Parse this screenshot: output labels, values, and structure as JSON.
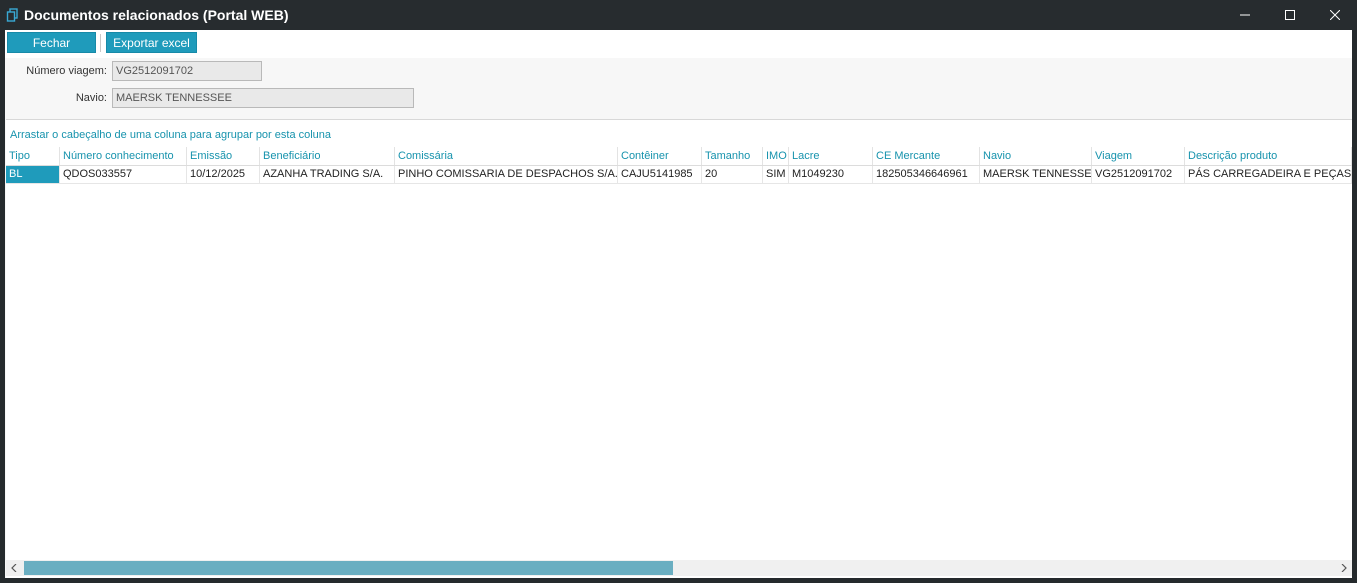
{
  "window": {
    "title": "Documentos relacionados (Portal WEB)",
    "icon": "app-document-icon"
  },
  "toolbar": {
    "fechar_label": "Fechar",
    "exportar_label": "Exportar excel"
  },
  "form": {
    "numero_viagem_label": "Número viagem:",
    "numero_viagem_value": "VG2512091702",
    "navio_label": "Navio:",
    "navio_value": "MAERSK TENNESSEE"
  },
  "grid": {
    "group_hint": "Arrastar o cabeçalho de uma coluna para agrupar por esta coluna",
    "columns": [
      "Tipo",
      "Número conhecimento",
      "Emissão",
      "Beneficiário",
      "Comissária",
      "Contêiner",
      "Tamanho",
      "IMO",
      "Lacre",
      "CE Mercante",
      "Navio",
      "Viagem",
      "Descrição produto"
    ],
    "rows": [
      [
        "BL",
        "QDOS033557",
        "10/12/2025",
        "AZANHA TRADING S/A.",
        "PINHO COMISSARIA DE DESPACHOS S/A.",
        "CAJU5141985",
        "20",
        "SIM",
        "M1049230",
        "182505346646961",
        "MAERSK TENNESSEE",
        "VG2512091702",
        "PÁS CARREGADEIRA E PEÇAS"
      ]
    ]
  },
  "colors": {
    "accent": "#1f9bbb",
    "header_text": "#1793ad",
    "titlebar": "#272c2f",
    "scroll_thumb": "#6aaec1"
  }
}
